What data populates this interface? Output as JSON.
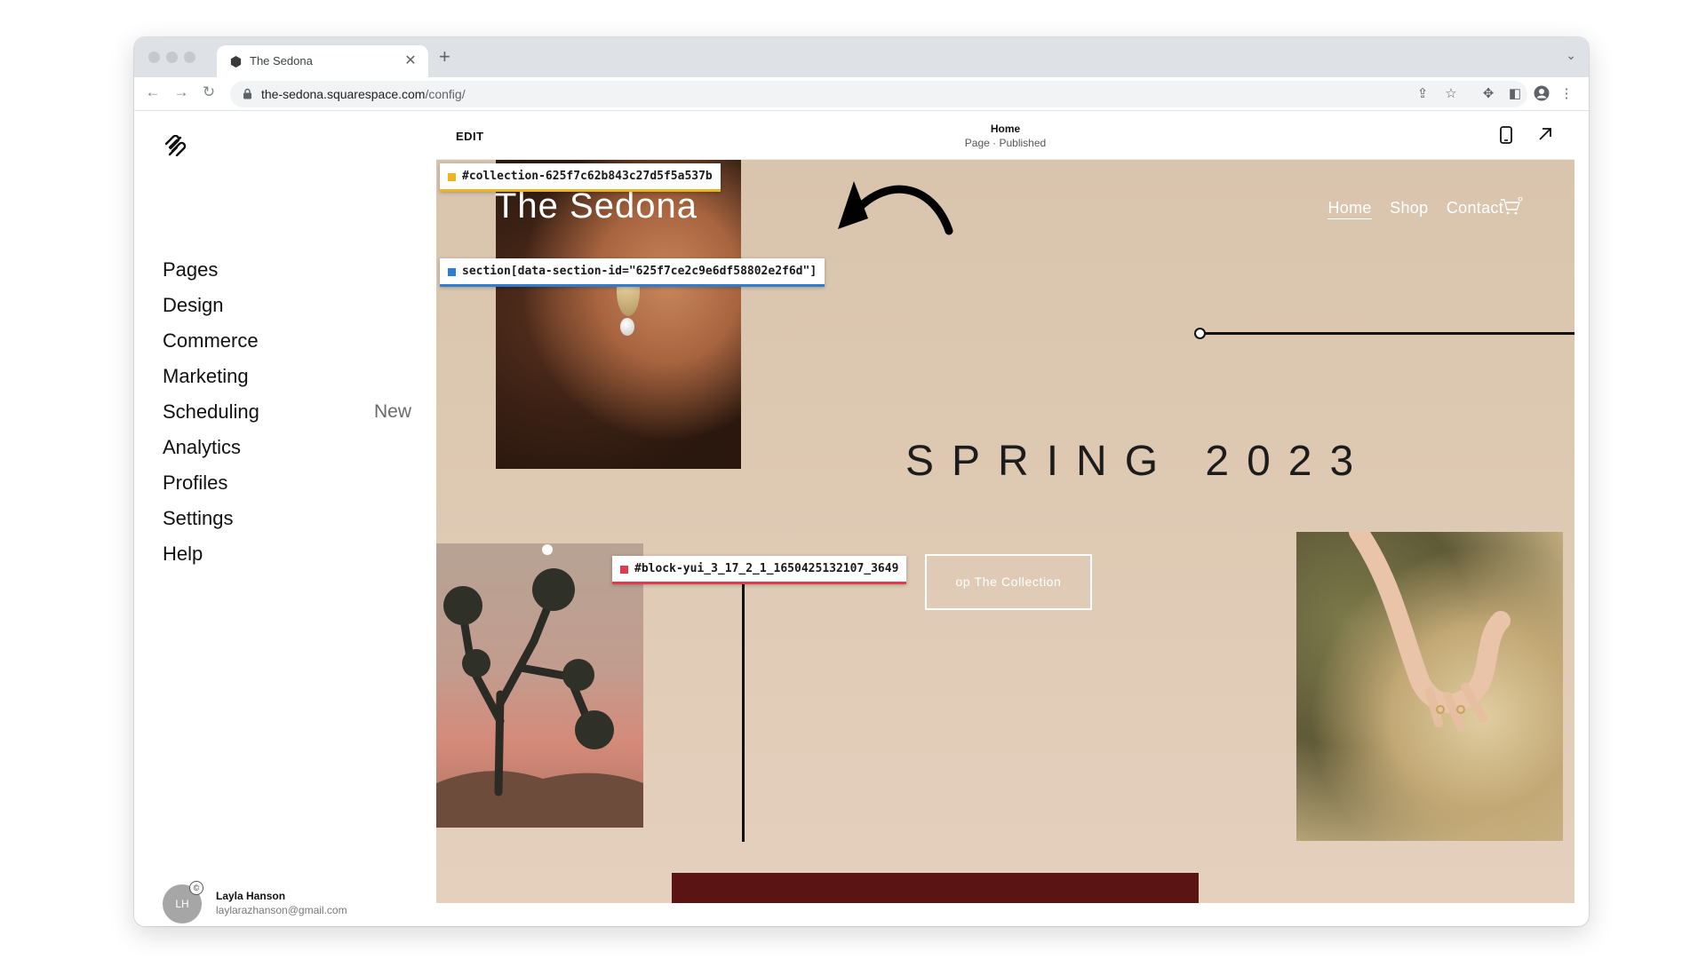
{
  "browser": {
    "tab_title": "The Sedona",
    "url_host": "the-sedona.squarespace.com",
    "url_path": "/config/"
  },
  "sidebar": {
    "items": [
      {
        "label": "Pages",
        "badge": ""
      },
      {
        "label": "Design",
        "badge": ""
      },
      {
        "label": "Commerce",
        "badge": ""
      },
      {
        "label": "Marketing",
        "badge": ""
      },
      {
        "label": "Scheduling",
        "badge": "New"
      },
      {
        "label": "Analytics",
        "badge": ""
      },
      {
        "label": "Profiles",
        "badge": ""
      },
      {
        "label": "Settings",
        "badge": ""
      },
      {
        "label": "Help",
        "badge": ""
      }
    ],
    "user": {
      "initials": "LH",
      "name": "Layla Hanson",
      "email": "laylarazhanson@gmail.com"
    }
  },
  "editor": {
    "edit_label": "EDIT",
    "page_name": "Home",
    "page_status": "Page · Published"
  },
  "site": {
    "title": "The Sedona",
    "nav": [
      "Home",
      "Shop",
      "Contact"
    ],
    "hero_heading": "SPRING 2023",
    "cta_label": "op The Collection"
  },
  "selectors": {
    "collection": "#collection-625f7c62b843c27d5f5a537b",
    "section": "section[data-section-id=\"625f7ce2c9e6df58802e2f6d\"]",
    "block": "#block-yui_3_17_2_1_1650425132107_3649"
  },
  "colors": {
    "selector_collection": "#f0b320",
    "selector_section": "#2d7dd2",
    "selector_block": "#e23a4c",
    "site_background": "#dcc7b0",
    "footer_strip": "#5a1414"
  }
}
